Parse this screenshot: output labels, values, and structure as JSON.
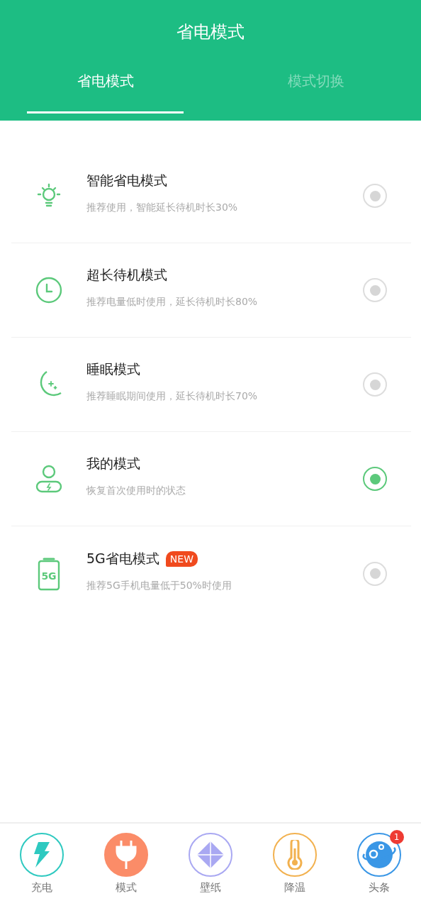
{
  "header": {
    "title": "省电模式"
  },
  "tabs": [
    {
      "label": "省电模式",
      "selected": true
    },
    {
      "label": "模式切换",
      "selected": false
    }
  ],
  "modes": [
    {
      "kind": "bulb",
      "title": "智能省电模式",
      "description": "推荐使用，智能延长待机时长30%",
      "selected": false
    },
    {
      "kind": "clock",
      "title": "超长待机模式",
      "description": "推荐电量低时使用，延长待机时长80%",
      "selected": false
    },
    {
      "kind": "moon",
      "title": "睡眠模式",
      "description": "推荐睡眠期间使用，延长待机时长70%",
      "selected": false
    },
    {
      "kind": "person",
      "title": "我的模式",
      "description": "恢复首次使用时的状态",
      "selected": true
    },
    {
      "kind": "battery",
      "icon_label": "5G",
      "title": "5G省电模式",
      "badge": "NEW",
      "description": "推荐5G手机电量低于50%时使用",
      "selected": false
    }
  ],
  "bottom_nav": [
    {
      "kind": "bolt",
      "label": "充电",
      "color": "#2ec9c0",
      "selected": false
    },
    {
      "kind": "plug",
      "label": "模式",
      "color": "#fb8c68",
      "selected": true
    },
    {
      "kind": "wallpaper",
      "label": "壁纸",
      "color": "#a9a8f2",
      "selected": false
    },
    {
      "kind": "thermometer",
      "label": "降温",
      "color": "#f2b14f",
      "selected": false
    },
    {
      "kind": "planet",
      "label": "头条",
      "color": "#3a97e6",
      "selected": false,
      "badge": "1"
    }
  ]
}
